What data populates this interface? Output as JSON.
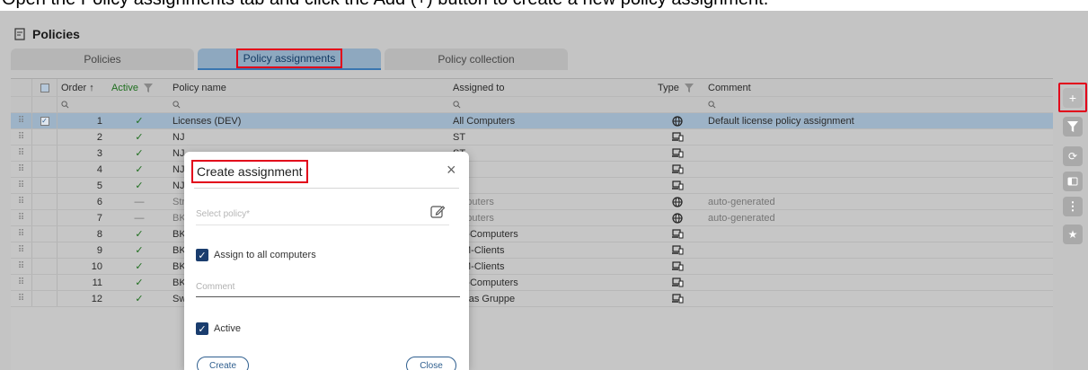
{
  "top_caption": "Open the Policy assignments tab and click the Add (+) button to create a new policy assignment.",
  "page": {
    "title": "Policies"
  },
  "tabs": [
    {
      "label": "Policies",
      "active": false
    },
    {
      "label": "Policy assignments",
      "active": true
    },
    {
      "label": "Policy collection",
      "active": false
    }
  ],
  "grid": {
    "columns": {
      "order": "Order",
      "active": "Active",
      "policy_name": "Policy name",
      "assigned_to": "Assigned to",
      "type": "Type",
      "comment": "Comment"
    },
    "rows": [
      {
        "order": "1",
        "active": "✓",
        "name": "Licenses (DEV)",
        "assigned": "All Computers",
        "type": "globe",
        "comment": "Default license policy assignment",
        "selected": true,
        "dim": false
      },
      {
        "order": "2",
        "active": "✓",
        "name": "NJ",
        "assigned": "ST",
        "type": "devices",
        "comment": "",
        "selected": false,
        "dim": false
      },
      {
        "order": "3",
        "active": "✓",
        "name": "NJ",
        "assigned": "ST",
        "type": "devices",
        "comment": "",
        "selected": false,
        "dim": false
      },
      {
        "order": "4",
        "active": "✓",
        "name": "NJ",
        "assigned": "ST",
        "type": "devices",
        "comment": "",
        "selected": false,
        "dim": false
      },
      {
        "order": "5",
        "active": "✓",
        "name": "NJ",
        "assigned": "ST",
        "type": "devices",
        "comment": "",
        "selected": false,
        "dim": false
      },
      {
        "order": "6",
        "active": "—",
        "name": "Str",
        "assigned": "omputers",
        "type": "globe",
        "comment": "auto-generated",
        "selected": false,
        "dim": true
      },
      {
        "order": "7",
        "active": "—",
        "name": "BK",
        "assigned": "omputers",
        "type": "globe",
        "comment": "auto-generated",
        "selected": false,
        "dim": true
      },
      {
        "order": "8",
        "active": "✓",
        "name": "BK",
        "assigned": "MT-Computers",
        "type": "devices",
        "comment": "",
        "selected": false,
        "dim": false
      },
      {
        "order": "9",
        "active": "✓",
        "name": "BK",
        "assigned": "-VM-Clients",
        "type": "devices",
        "comment": "",
        "selected": false,
        "dim": false
      },
      {
        "order": "10",
        "active": "✓",
        "name": "BK",
        "assigned": "-VM-Clients",
        "type": "devices",
        "comment": "",
        "selected": false,
        "dim": false
      },
      {
        "order": "11",
        "active": "✓",
        "name": "BK",
        "assigned": "MT-Computers",
        "type": "devices",
        "comment": "",
        "selected": false,
        "dim": false
      },
      {
        "order": "12",
        "active": "✓",
        "name": "Sw",
        "assigned": "tlanas Gruppe",
        "type": "devices",
        "comment": "",
        "selected": false,
        "dim": false
      }
    ]
  },
  "toolbar": [
    "plus-icon",
    "filter-icon",
    "refresh-icon",
    "panel-icon",
    "more-icon",
    "star-icon"
  ],
  "modal": {
    "title": "Create assignment",
    "policy_placeholder": "Select policy*",
    "assign_all_label": "Assign to all computers",
    "assign_all_checked": true,
    "comment_placeholder": "Comment",
    "active_label": "Active",
    "active_checked": true,
    "create_label": "Create",
    "close_label": "Close"
  },
  "colors": {
    "highlight": "#e2001a",
    "accent": "#1a3d6e",
    "active_tab": "#8ea8bf",
    "check_green": "#1f6f1f"
  }
}
